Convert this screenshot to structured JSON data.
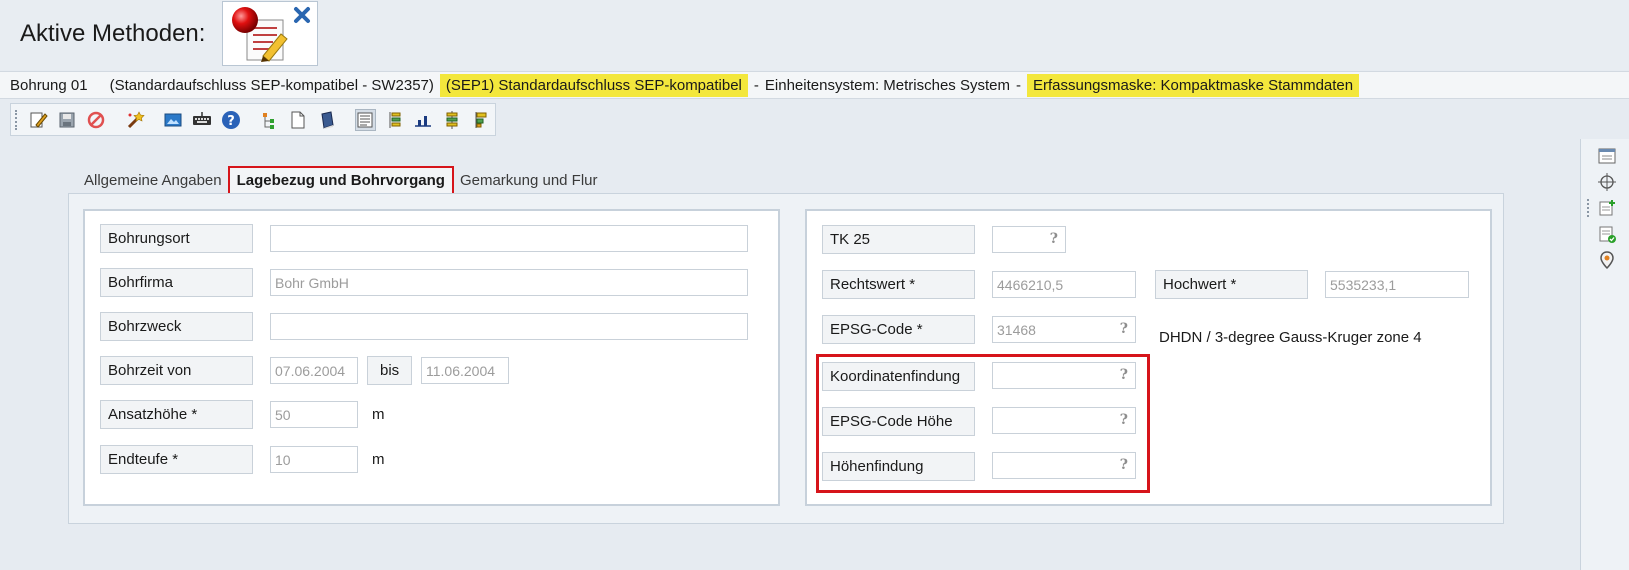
{
  "header": {
    "title": "Aktive Methoden:"
  },
  "infobar": {
    "bohrung": "Bohrung 01",
    "standard": "(Standardaufschluss SEP-kompatibel - SW2357)",
    "sep1": "(SEP1) Standardaufschluss SEP-kompatibel",
    "dash1": "-",
    "einheiten": "Einheitensystem: Metrisches System",
    "dash2": "-",
    "erfassung": "Erfassungsmaske: Kompaktmaske Stammdaten"
  },
  "colors": {
    "highlight": "#f3e73c",
    "annotation_red": "#d6141a"
  },
  "toolbar_icons": [
    "edit-icon",
    "save-icon",
    "cancel-icon",
    "magic-wand-icon",
    "image-icon",
    "keyboard-icon",
    "help-icon",
    "tree-add-icon",
    "document-icon",
    "book-icon",
    "form-view-icon",
    "table-view-icon",
    "chart-icon",
    "structure-icon",
    "layout-icon"
  ],
  "tabs": [
    "Allgemeine Angaben",
    "Lagebezug und Bohrvorgang",
    "Gemarkung und Flur"
  ],
  "left": {
    "bohrungsort": {
      "label": "Bohrungsort",
      "value": ""
    },
    "bohrfirma": {
      "label": "Bohrfirma",
      "value": "Bohr GmbH"
    },
    "bohrzweck": {
      "label": "Bohrzweck",
      "value": ""
    },
    "bohrzeit": {
      "label": "Bohrzeit von",
      "from": "07.06.2004",
      "bis_label": "bis",
      "to": "11.06.2004"
    },
    "ansatzhoehe": {
      "label": "Ansatzhöhe *",
      "value": "50",
      "unit": "m"
    },
    "endteufe": {
      "label": "Endteufe *",
      "value": "10",
      "unit": "m"
    }
  },
  "right": {
    "tk25": {
      "label": "TK 25",
      "value": ""
    },
    "rechtswert": {
      "label": "Rechtswert *",
      "value": "4466210,5"
    },
    "hochwert": {
      "label": "Hochwert *",
      "value": "5535233,1"
    },
    "epsg": {
      "label": "EPSG-Code *",
      "value": "31468",
      "description": "DHDN / 3-degree Gauss-Kruger zone 4"
    },
    "koordinatenfindung": {
      "label": "Koordinatenfindung",
      "value": ""
    },
    "epsg_hoehe": {
      "label": "EPSG-Code Höhe",
      "value": ""
    },
    "hoehenfindung": {
      "label": "Höhenfindung",
      "value": ""
    }
  },
  "lookup_glyph": "?",
  "side_icons": [
    "panel-icon",
    "crosshair-icon",
    "add-record-icon",
    "checklist-icon",
    "location-pin-icon"
  ]
}
